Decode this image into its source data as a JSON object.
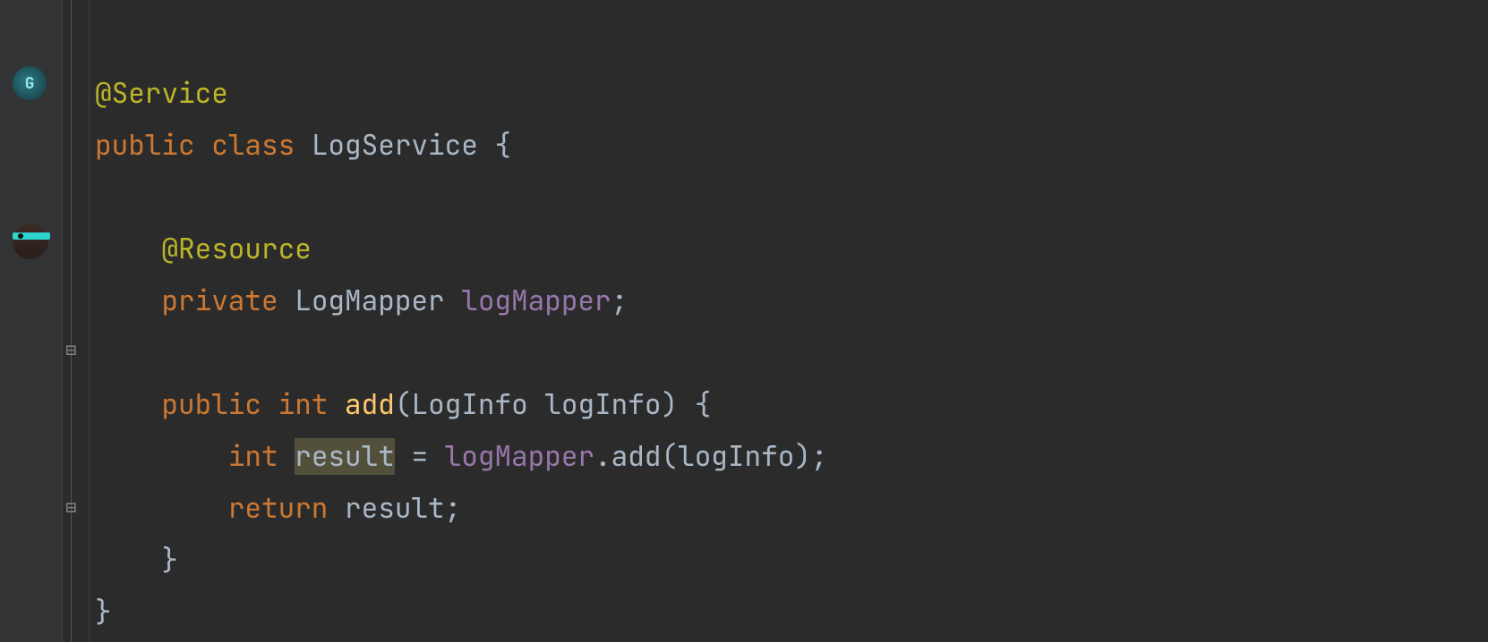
{
  "code": {
    "line1": {
      "annotation": "@Service"
    },
    "line2": {
      "kw_public": "public",
      "kw_class": "class",
      "classname": "LogService",
      "brace": " {"
    },
    "line3": "",
    "line4": {
      "annotation": "@Resource"
    },
    "line5": {
      "kw_private": "private",
      "type": "LogMapper",
      "field": "logMapper",
      "semi": ";"
    },
    "line6": "",
    "line7": {
      "kw_public": "public",
      "kw_int": "int",
      "method": "add",
      "open": "(",
      "ptype": "LogInfo",
      "pname": "logInfo",
      "close": ")",
      "brace": " {"
    },
    "line8": {
      "kw_int": "int",
      "var": "result",
      "eq": " = ",
      "ref": "logMapper",
      "dot": ".",
      "call": "add",
      "open": "(",
      "arg": "logInfo",
      "close": ")",
      "semi": ";"
    },
    "line9": {
      "kw_return": "return",
      "var": "result",
      "semi": ";"
    },
    "line10": {
      "brace": "}"
    },
    "line11": {
      "brace": "}"
    }
  },
  "gutter": {
    "icon1_name": "spring-service-icon",
    "icon2_name": "mybatis-mapper-icon",
    "run1_name": "run-gutter-icon",
    "run2_name": "run-gutter-icon",
    "fold_open": "⊟",
    "fold_join": "⊟"
  }
}
